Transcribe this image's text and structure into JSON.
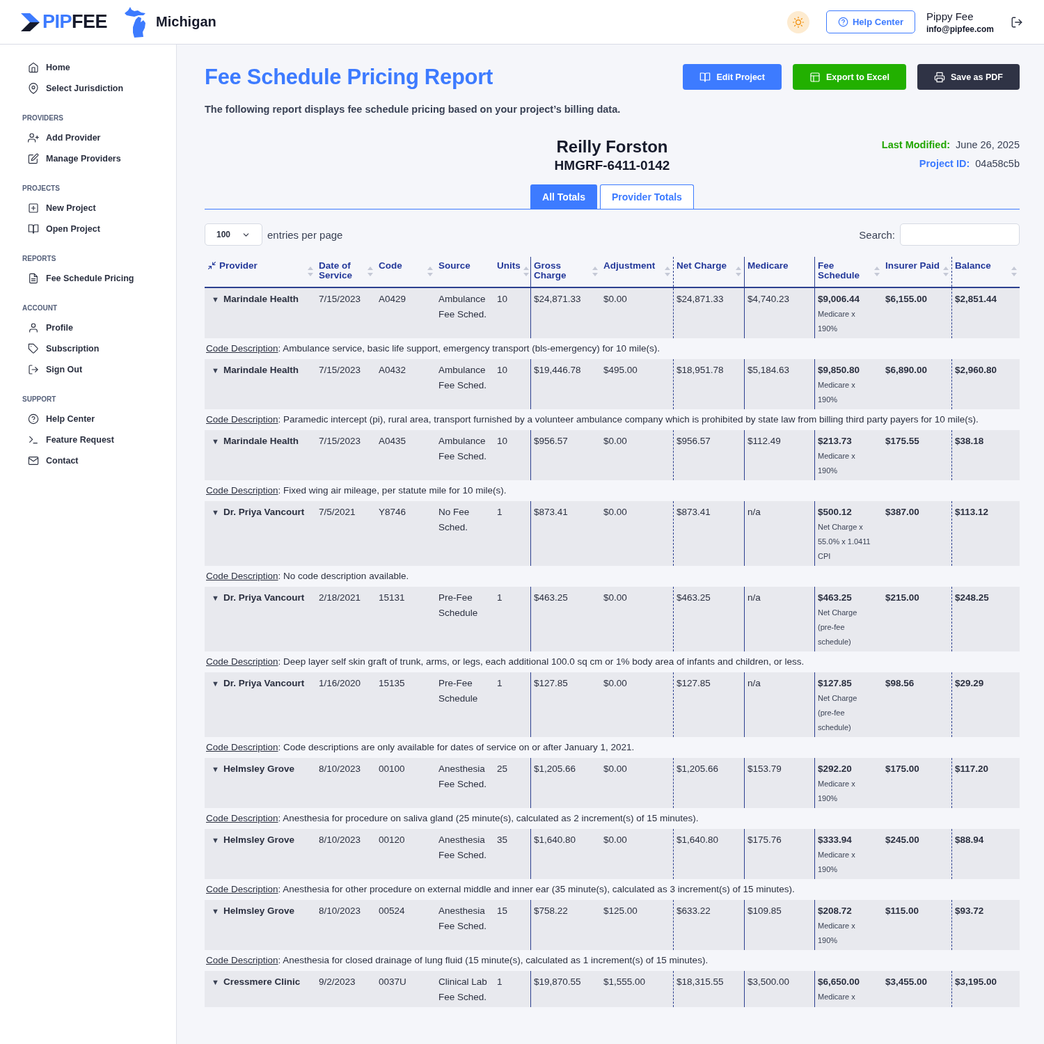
{
  "header": {
    "logo": [
      "PIP",
      "FEE"
    ],
    "state": "Michigan",
    "help_button": "Help Center",
    "user": {
      "name": "Pippy Fee",
      "email": "info@pipfee.com"
    }
  },
  "sidebar": {
    "sections": [
      {
        "items": [
          {
            "label": "Home"
          },
          {
            "label": "Select Jurisdiction"
          }
        ]
      },
      {
        "heading": "PROVIDERS",
        "items": [
          {
            "label": "Add Provider"
          },
          {
            "label": "Manage Providers"
          }
        ]
      },
      {
        "heading": "PROJECTS",
        "items": [
          {
            "label": "New Project"
          },
          {
            "label": "Open Project"
          }
        ]
      },
      {
        "heading": "REPORTS",
        "items": [
          {
            "label": "Fee Schedule Pricing"
          }
        ]
      },
      {
        "heading": "ACCOUNT",
        "items": [
          {
            "label": "Profile"
          },
          {
            "label": "Subscription"
          },
          {
            "label": "Sign Out"
          }
        ]
      },
      {
        "heading": "SUPPORT",
        "items": [
          {
            "label": "Help Center"
          },
          {
            "label": "Feature Request"
          },
          {
            "label": "Contact"
          }
        ]
      }
    ]
  },
  "report": {
    "title": "Fee Schedule Pricing Report",
    "subtitle": "The following report displays fee schedule pricing based on your project’s billing data.",
    "buttons": [
      {
        "label": "Edit Project",
        "kind": "edit"
      },
      {
        "label": "Export to Excel",
        "kind": "excel"
      },
      {
        "label": "Save as PDF",
        "kind": "pdf"
      }
    ],
    "client_name": "Reilly Forston",
    "client_id": "HMGRF-6411-0142",
    "meta": [
      {
        "label": "Last Modified:",
        "value": "June 26, 2025",
        "color": "#22a600"
      },
      {
        "label": "Project ID:",
        "value": "04a58c5b",
        "color": "#3d7bff"
      }
    ],
    "tabs": [
      {
        "label": "All Totals",
        "selected": true
      },
      {
        "label": "Provider Totals",
        "selected": false
      }
    ],
    "entries": {
      "value": "100",
      "label": "entries per page"
    },
    "search": {
      "label": "Search:"
    }
  },
  "table": {
    "columns": [
      {
        "label": "Provider",
        "sortable": true
      },
      {
        "label": "Date of Service",
        "sortable": true
      },
      {
        "label": "Code",
        "sortable": true
      },
      {
        "label": "Source",
        "sortable": false
      },
      {
        "label": "Units",
        "sortable": true
      },
      {
        "label": "Gross Charge",
        "sortable": true
      },
      {
        "label": "Adjustment",
        "sortable": true
      },
      {
        "label": "Net Charge",
        "sortable": true
      },
      {
        "label": "Medicare",
        "sortable": false
      },
      {
        "label": "Fee Schedule",
        "sortable": true
      },
      {
        "label": "Insurer Paid",
        "sortable": true
      },
      {
        "label": "Balance",
        "sortable": true
      }
    ],
    "rows": [
      {
        "toggle": "▼",
        "provider": "Marindale Health",
        "date": "7/15/2023",
        "code": "A0429",
        "source": "Ambulance Fee Sched.",
        "units": "10",
        "gross": "$24,871.33",
        "adjustment": "$0.00",
        "net_charge": "$24,871.33",
        "medicare": "$4,740.23",
        "fee_schedule": "$9,006.44",
        "fee_note": "Medicare x 190%",
        "insurer_paid": "$6,155.00",
        "balance": "$2,851.44",
        "description_label": "Code Description",
        "description": ": Ambulance service, basic life support, emergency transport (bls-emergency) for 10 mile(s)."
      },
      {
        "toggle": "▼",
        "provider": "Marindale Health",
        "date": "7/15/2023",
        "code": "A0432",
        "source": "Ambulance Fee Sched.",
        "units": "10",
        "gross": "$19,446.78",
        "adjustment": "$495.00",
        "net_charge": "$18,951.78",
        "medicare": "$5,184.63",
        "fee_schedule": "$9,850.80",
        "fee_note": "Medicare x 190%",
        "insurer_paid": "$6,890.00",
        "balance": "$2,960.80",
        "description_label": "Code Description",
        "description": ": Paramedic intercept (pi), rural area, transport furnished by a volunteer ambulance company which is prohibited by state law from billing third party payers for 10 mile(s)."
      },
      {
        "toggle": "▼",
        "provider": "Marindale Health",
        "date": "7/15/2023",
        "code": "A0435",
        "source": "Ambulance Fee Sched.",
        "units": "10",
        "gross": "$956.57",
        "adjustment": "$0.00",
        "net_charge": "$956.57",
        "medicare": "$112.49",
        "fee_schedule": "$213.73",
        "fee_note": "Medicare x 190%",
        "insurer_paid": "$175.55",
        "balance": "$38.18",
        "description_label": "Code Description",
        "description": ": Fixed wing air mileage, per statute mile for 10 mile(s)."
      },
      {
        "toggle": "▼",
        "provider": "Dr. Priya Vancourt",
        "date": "7/5/2021",
        "code": "Y8746",
        "source": "No Fee Sched.",
        "units": "1",
        "gross": "$873.41",
        "adjustment": "$0.00",
        "net_charge": "$873.41",
        "medicare": "n/a",
        "fee_schedule": "$500.12",
        "fee_note": "Net Charge x 55.0% x 1.0411 CPI",
        "insurer_paid": "$387.00",
        "balance": "$113.12",
        "description_label": "Code Description",
        "description": ": No code description available."
      },
      {
        "toggle": "▼",
        "provider": "Dr. Priya Vancourt",
        "date": "2/18/2021",
        "code": "15131",
        "source": "Pre-Fee Schedule",
        "units": "1",
        "gross": "$463.25",
        "adjustment": "$0.00",
        "net_charge": "$463.25",
        "medicare": "n/a",
        "fee_schedule": "$463.25",
        "fee_note": "Net Charge (pre-fee schedule)",
        "insurer_paid": "$215.00",
        "balance": "$248.25",
        "description_label": "Code Description",
        "description": ": Deep layer self skin graft of trunk, arms, or legs, each additional 100.0 sq cm or 1% body area of infants and children, or less."
      },
      {
        "toggle": "▼",
        "provider": "Dr. Priya Vancourt",
        "date": "1/16/2020",
        "code": "15135",
        "source": "Pre-Fee Schedule",
        "units": "1",
        "gross": "$127.85",
        "adjustment": "$0.00",
        "net_charge": "$127.85",
        "medicare": "n/a",
        "fee_schedule": "$127.85",
        "fee_note": "Net Charge (pre-fee schedule)",
        "insurer_paid": "$98.56",
        "balance": "$29.29",
        "description_label": "Code Description",
        "description": ": Code descriptions are only available for dates of service on or after January 1, 2021."
      },
      {
        "toggle": "▼",
        "provider": "Helmsley Grove",
        "date": "8/10/2023",
        "code": "00100",
        "source": "Anesthesia Fee Sched.",
        "units": "25",
        "gross": "$1,205.66",
        "adjustment": "$0.00",
        "net_charge": "$1,205.66",
        "medicare": "$153.79",
        "fee_schedule": "$292.20",
        "fee_note": "Medicare x 190%",
        "insurer_paid": "$175.00",
        "balance": "$117.20",
        "description_label": "Code Description",
        "description": ": Anesthesia for procedure on saliva gland (25 minute(s), calculated as 2 increment(s) of 15 minutes)."
      },
      {
        "toggle": "▼",
        "provider": "Helmsley Grove",
        "date": "8/10/2023",
        "code": "00120",
        "source": "Anesthesia Fee Sched.",
        "units": "35",
        "gross": "$1,640.80",
        "adjustment": "$0.00",
        "net_charge": "$1,640.80",
        "medicare": "$175.76",
        "fee_schedule": "$333.94",
        "fee_note": "Medicare x 190%",
        "insurer_paid": "$245.00",
        "balance": "$88.94",
        "description_label": "Code Description",
        "description": ": Anesthesia for other procedure on external middle and inner ear (35 minute(s), calculated as 3 increment(s) of 15 minutes)."
      },
      {
        "toggle": "▼",
        "provider": "Helmsley Grove",
        "date": "8/10/2023",
        "code": "00524",
        "source": "Anesthesia Fee Sched.",
        "units": "15",
        "gross": "$758.22",
        "adjustment": "$125.00",
        "net_charge": "$633.22",
        "medicare": "$109.85",
        "fee_schedule": "$208.72",
        "fee_note": "Medicare x 190%",
        "insurer_paid": "$115.00",
        "balance": "$93.72",
        "description_label": "Code Description",
        "description": ": Anesthesia for closed drainage of lung fluid (15 minute(s), calculated as 1 increment(s) of 15 minutes)."
      },
      {
        "toggle": "▼",
        "provider": "Cressmere Clinic",
        "date": "9/2/2023",
        "code": "0037U",
        "source": "Clinical Lab Fee Sched.",
        "units": "1",
        "gross": "$19,870.55",
        "adjustment": "$1,555.00",
        "net_charge": "$18,315.55",
        "medicare": "$3,500.00",
        "fee_schedule": "$6,650.00",
        "fee_note": "Medicare x",
        "insurer_paid": "$3,455.00",
        "balance": "$3,195.00"
      }
    ]
  }
}
